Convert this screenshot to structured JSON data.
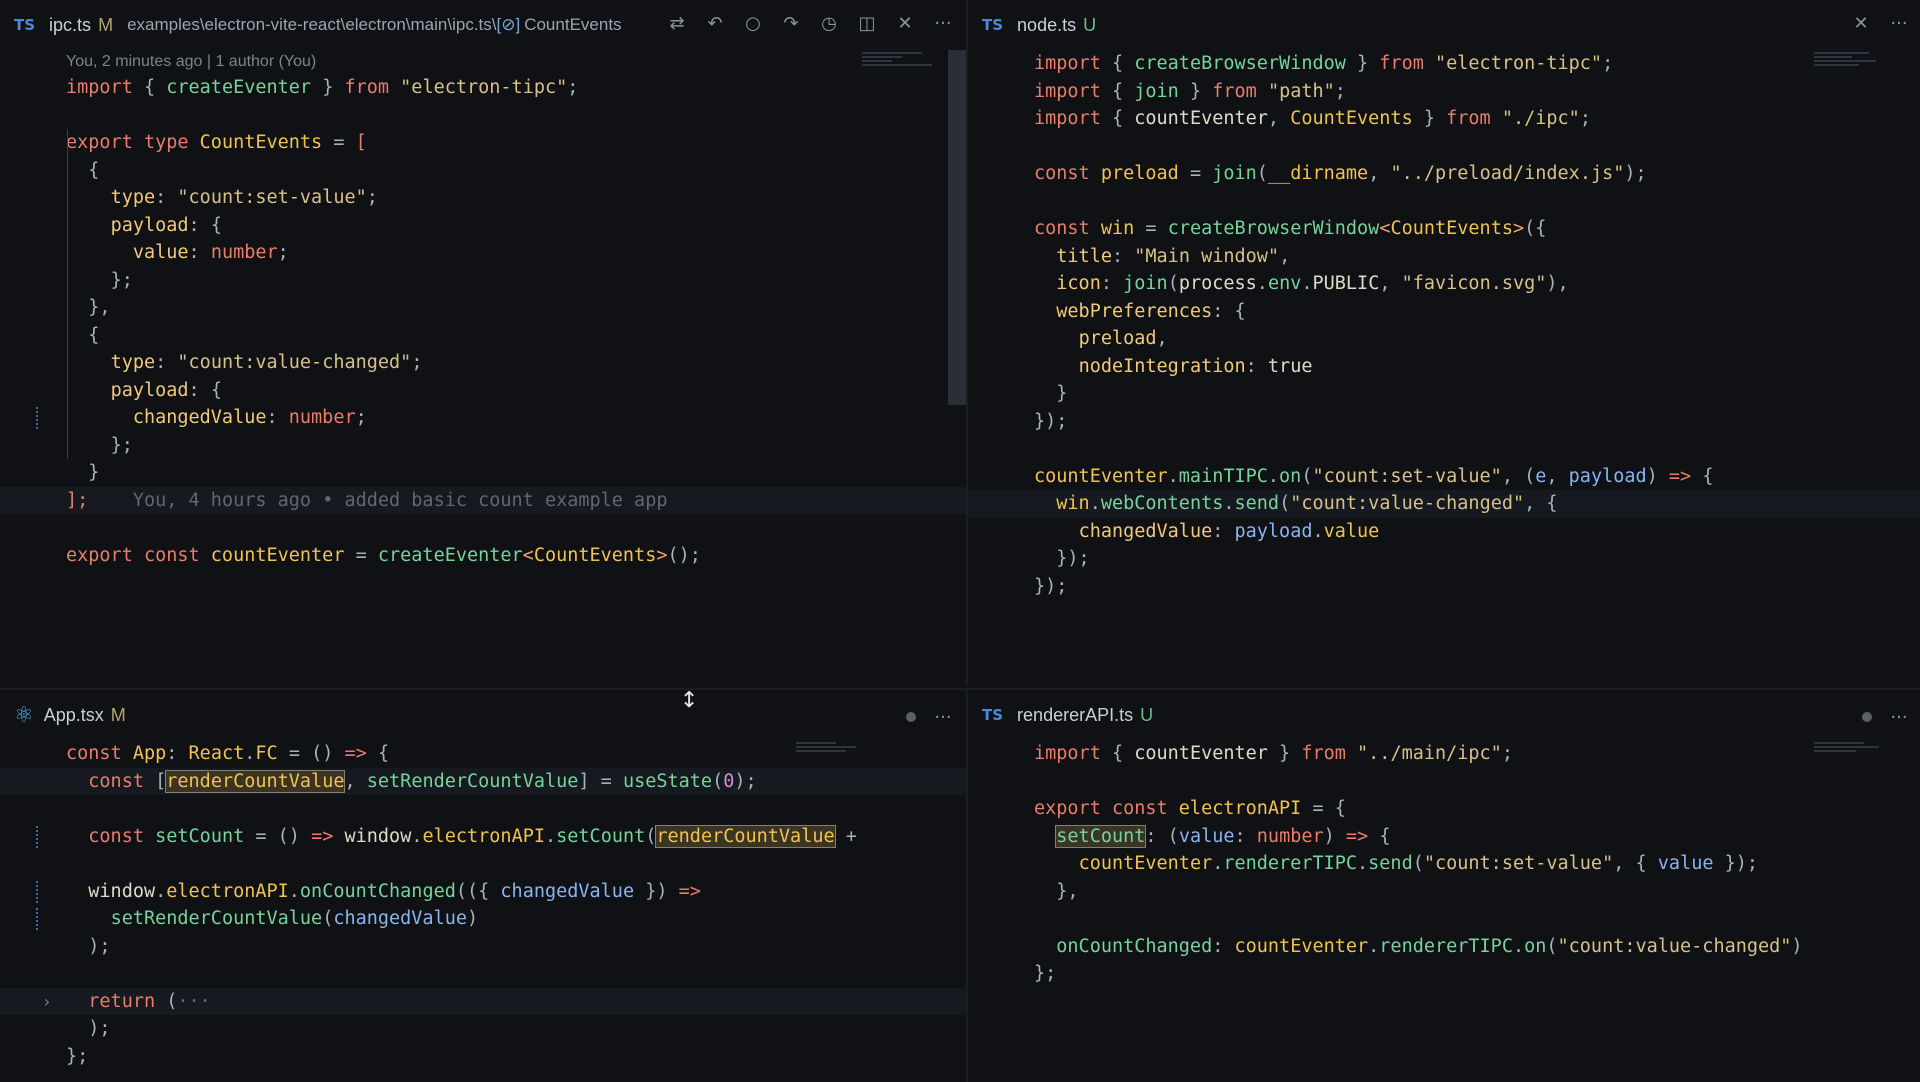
{
  "panes": {
    "top_left": {
      "lang_badge": "TS",
      "file": "ipc.ts",
      "status": "M",
      "breadcrumb": "examples\\electron-vite-react\\electron\\main\\ipc.ts\\",
      "symbol_icon": "[⊘]",
      "symbol": "CountEvents",
      "codelens": "You, 2 minutes ago | 1 author (You)",
      "blame": "You, 4 hours ago • added basic count example app",
      "icons": [
        "git-compare-icon",
        "go-back-icon",
        "circle-icon",
        "go-forward-icon",
        "timeline-icon",
        "split-editor-icon",
        "close-icon",
        "more-icon"
      ]
    },
    "top_right": {
      "lang_badge": "TS",
      "file": "node.ts",
      "status": "U"
    },
    "bottom_left": {
      "lang_badge": "⚛",
      "file": "App.tsx",
      "status": "M"
    },
    "bottom_right": {
      "lang_badge": "TS",
      "file": "rendererAPI.ts",
      "status": "U"
    }
  }
}
